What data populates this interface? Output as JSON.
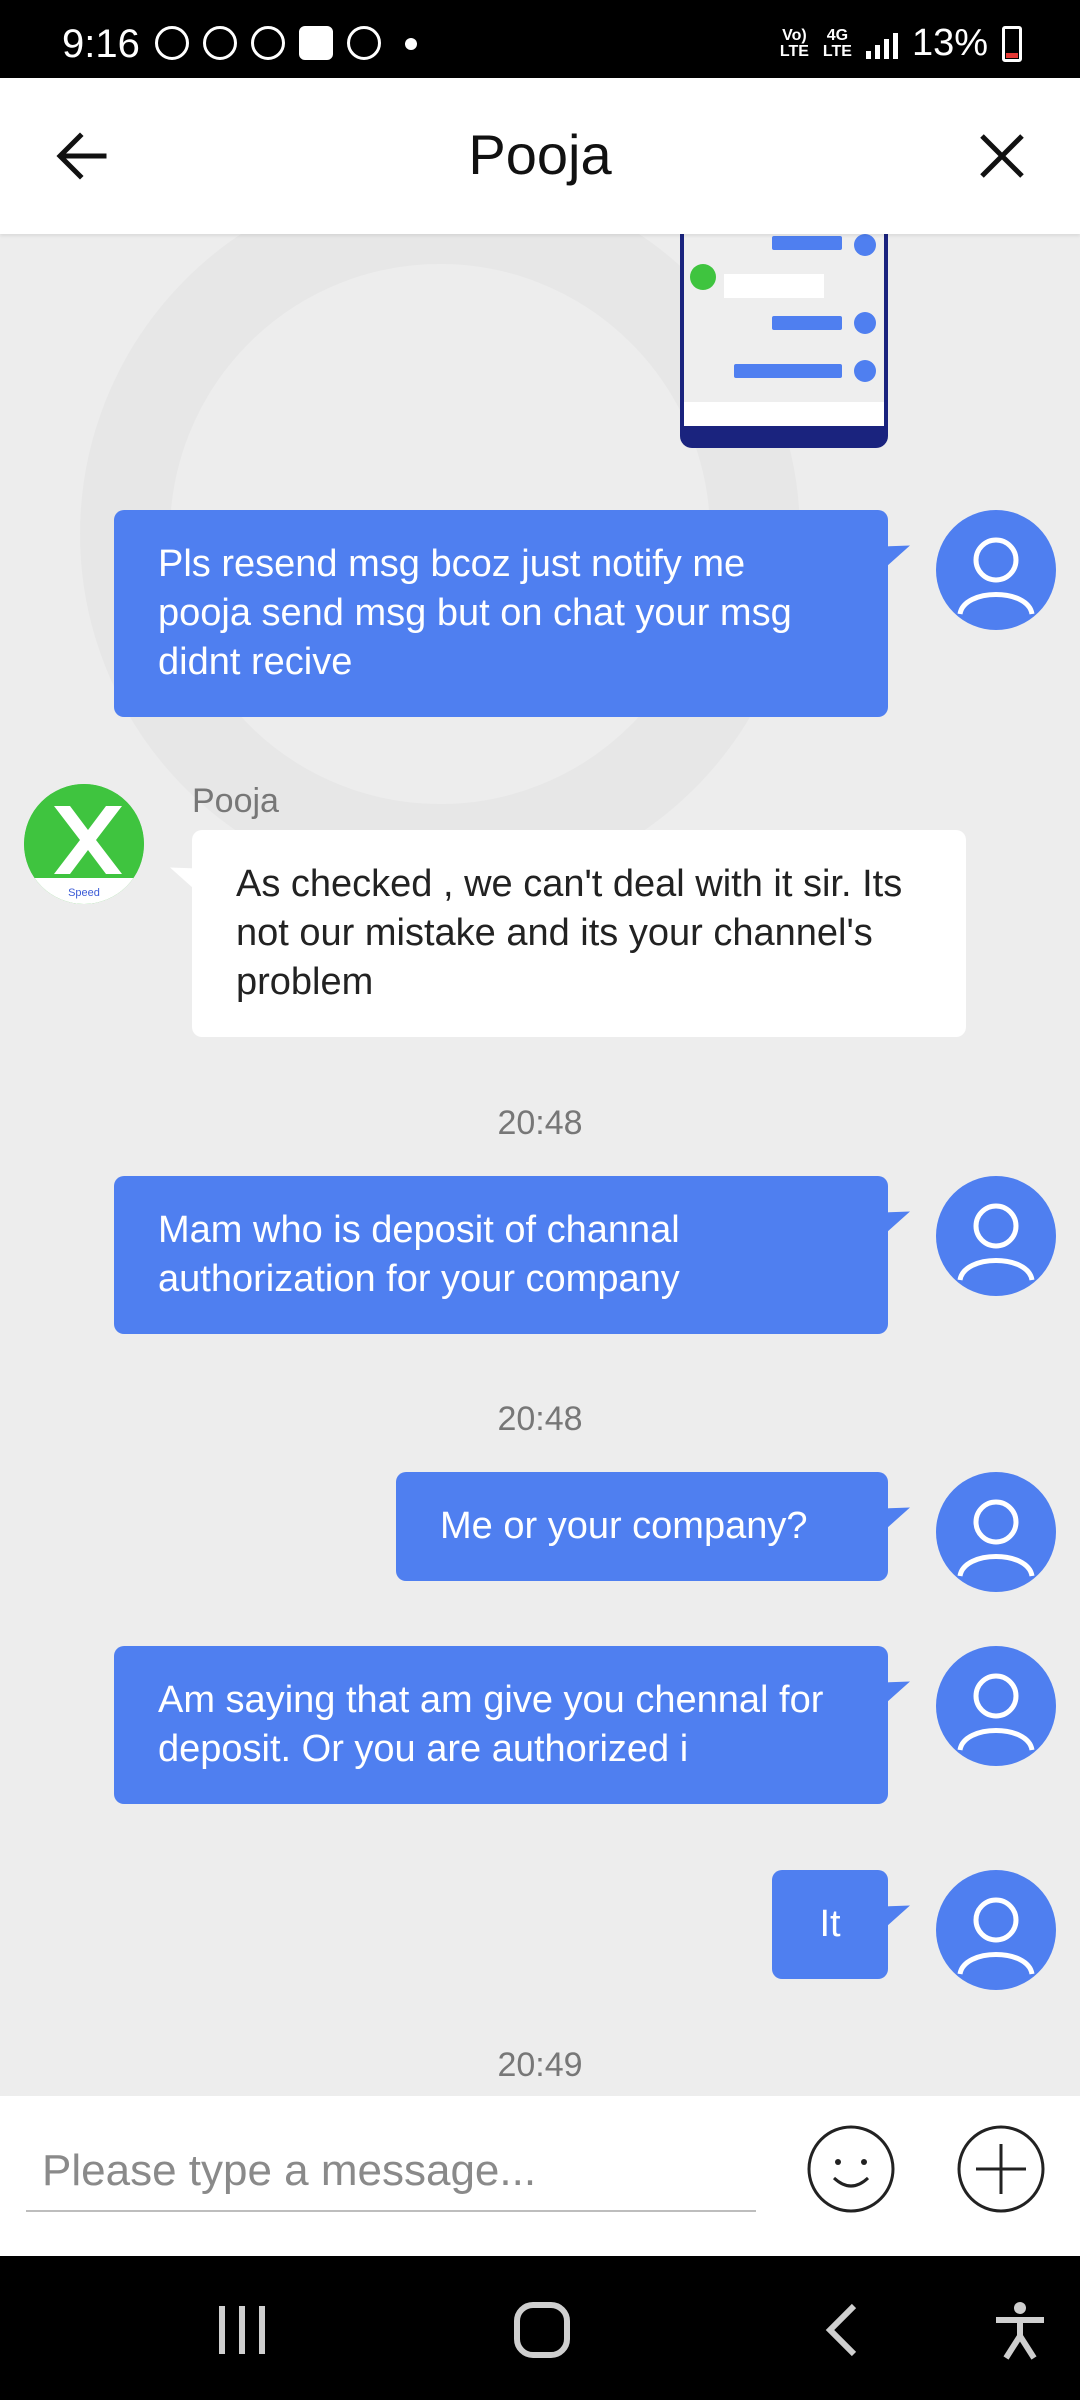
{
  "status_bar": {
    "time": "9:16",
    "network_top": "Vo)",
    "network_bottom": "LTE",
    "data_top": "4G",
    "data_bottom": "LTE",
    "battery": "13%",
    "battery_color": "#e53935"
  },
  "header": {
    "title": "Pooja",
    "back_icon": "arrow-left-icon",
    "close_icon": "close-icon"
  },
  "chat": {
    "accent_color": "#4f7ff0",
    "messages": [
      {
        "sender": "me",
        "text": "Pls resend msg bcoz just notify me pooja send msg but on chat your msg didnt recive"
      },
      {
        "sender": "agent",
        "name": "Pooja",
        "avatar_label": "Speed",
        "text": "As checked , we can't deal with it sir. Its not our mistake and its your channel's problem"
      },
      {
        "sender": "me",
        "timestamp": "20:48",
        "text": "Mam who is deposit of channal authorization for your company"
      },
      {
        "sender": "me",
        "timestamp": "20:48",
        "text": "Me or your company?"
      },
      {
        "sender": "me",
        "text": "Am saying that am give you chennal for deposit.  Or you are authorized i"
      },
      {
        "sender": "me",
        "text": "It"
      }
    ],
    "last_timestamp": "20:49"
  },
  "input_bar": {
    "placeholder": "Please type a message...",
    "emoji_icon": "smiley-icon",
    "add_icon": "plus-icon"
  },
  "nav_bar": {
    "recents_icon": "recents-icon",
    "home_icon": "home-icon",
    "back_icon": "back-chevron-icon",
    "accessibility_icon": "accessibility-icon"
  }
}
